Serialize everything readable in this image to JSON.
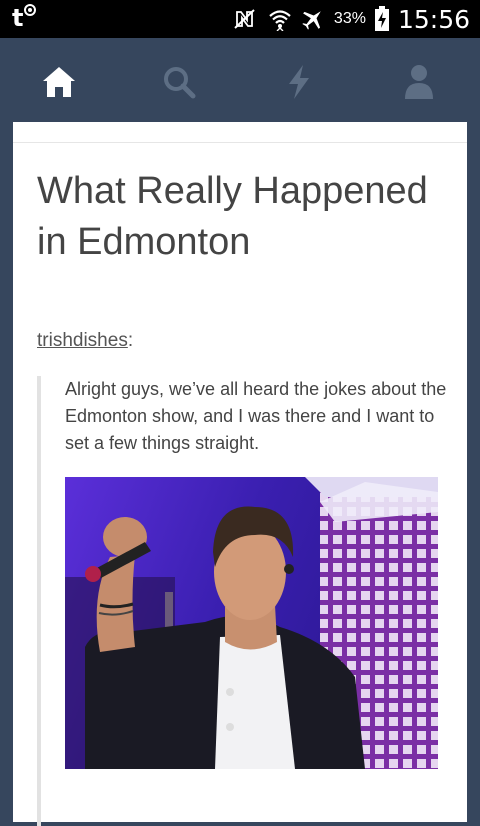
{
  "status_bar": {
    "app_icon": "tumblr-notification-icon",
    "app_letter": "t",
    "icons": [
      "nfc-icon",
      "wifi-icon",
      "airplane-mode-icon"
    ],
    "battery_percent": "33%",
    "battery_icon": "battery-charging-icon",
    "time": "15:56"
  },
  "navbar": {
    "items": [
      {
        "icon": "home-icon",
        "active": true
      },
      {
        "icon": "search-icon",
        "active": false
      },
      {
        "icon": "activity-lightning-icon",
        "active": false
      },
      {
        "icon": "account-icon",
        "active": false
      }
    ],
    "active_color": "#ffffff",
    "inactive_color": "#5d6e84"
  },
  "post": {
    "title": "What Really Happened in Edmonton",
    "author": "trishdishes",
    "author_suffix": ":",
    "quote": "Alright guys, we’ve all heard the jokes about the Edmonton show, and I was there and I want to set a few things straight.",
    "image_icon": "concert-photo"
  },
  "colors": {
    "navy": "#36465d",
    "text": "#444444"
  }
}
